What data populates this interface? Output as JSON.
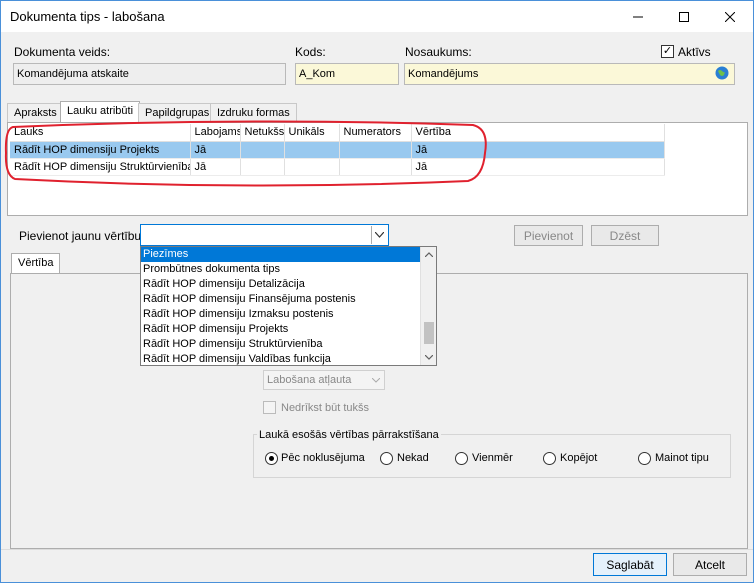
{
  "window": {
    "title": "Dokumenta tips - labošana"
  },
  "header": {
    "doc_type_label": "Dokumenta veids:",
    "doc_type_value": "Komandējuma atskaite",
    "code_label": "Kods:",
    "code_value": "A_Kom",
    "name_label": "Nosaukums:",
    "name_value": "Komandējums",
    "active_label": "Aktīvs",
    "active_checked": true
  },
  "tabs": [
    "Apraksts",
    "Lauku atribūti",
    "Papildgrupas",
    "Izdruku formas"
  ],
  "grid": {
    "columns": [
      "Lauks",
      "Labojams",
      "Netukšs",
      "Unikāls",
      "Numerators",
      "Vērtība"
    ],
    "rows": [
      [
        "Rādīt HOP dimensiju Projekts",
        "Jā",
        "",
        "",
        "",
        "Jā"
      ],
      [
        "Rādīt HOP dimensiju Struktūrvienība",
        "Jā",
        "",
        "",
        "",
        "Jā"
      ]
    ]
  },
  "add_value": {
    "label": "Pievienot jaunu vērtību:",
    "add_button": "Pievienot",
    "delete_button": "Dzēst"
  },
  "dropdown_items": [
    "Piezīmes",
    "Prombūtnes dokumenta tips",
    "Rādīt HOP dimensiju Detalizācija",
    "Rādīt HOP dimensiju Finansējuma postenis",
    "Rādīt HOP dimensiju Izmaksu postenis",
    "Rādīt HOP dimensiju Projekts",
    "Rādīt HOP dimensiju Struktūrvienība",
    "Rādīt HOP dimensiju Valdības funkcija"
  ],
  "value_tab": "Vērtība",
  "edit_permission": "Labošana atļauta",
  "no_empty_label": "Nedrīkst būt tukšs",
  "overwrite": {
    "group_label": "Laukā esošās vērtības pārrakstīšana",
    "options": [
      "Pēc noklusējuma",
      "Nekad",
      "Vienmēr",
      "Kopējot",
      "Mainot tipu"
    ],
    "selected_index": 0
  },
  "footer": {
    "save": "Saglabāt",
    "cancel": "Atcelt"
  },
  "colors": {
    "highlight": "#99c9ef",
    "selection": "#0078d7",
    "annotation": "#e0212e"
  }
}
